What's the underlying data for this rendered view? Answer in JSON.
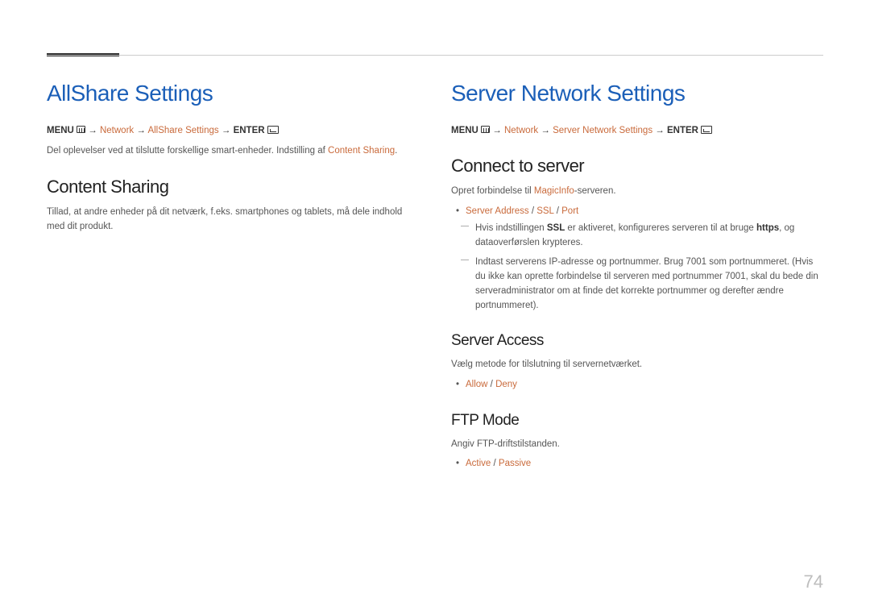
{
  "page_number": "74",
  "left": {
    "h1": "AllShare Settings",
    "crumb": {
      "menu": "MENU",
      "arrow": "→",
      "network": "Network",
      "item": "AllShare Settings",
      "enter": "ENTER"
    },
    "intro_pre": "Del oplevelser ved at tilslutte forskellige smart-enheder. Indstilling af ",
    "intro_link": "Content Sharing",
    "intro_post": ".",
    "h2": "Content Sharing",
    "p1": "Tillad, at andre enheder på dit netværk, f.eks. smartphones og tablets, må dele indhold med dit produkt."
  },
  "right": {
    "h1": "Server Network Settings",
    "crumb": {
      "menu": "MENU",
      "arrow": "→",
      "network": "Network",
      "item": "Server Network Settings",
      "enter": "ENTER"
    },
    "connect": {
      "h2": "Connect to server",
      "p_pre": "Opret forbindelse til ",
      "p_link": "MagicInfo",
      "p_post": "-serveren.",
      "bullet": {
        "a": "Server Address",
        "sep": " / ",
        "b": "SSL",
        "c": "Port"
      },
      "dash1_pre": "Hvis indstillingen ",
      "dash1_b": "SSL",
      "dash1_mid": " er aktiveret, konfigureres serveren til at bruge ",
      "dash1_b2": "https",
      "dash1_post": ", og dataoverførslen krypteres.",
      "dash2": "Indtast serverens IP-adresse og portnummer. Brug 7001 som portnummeret. (Hvis du ikke kan oprette forbindelse til serveren med portnummer 7001, skal du bede din serveradministrator om at finde det korrekte portnummer og derefter ændre portnummeret)."
    },
    "access": {
      "h3": "Server Access",
      "p": "Vælg metode for tilslutning til servernetværket.",
      "bullet": {
        "a": "Allow",
        "sep": " / ",
        "b": "Deny"
      }
    },
    "ftp": {
      "h3": "FTP Mode",
      "p": "Angiv FTP-driftstilstanden.",
      "bullet": {
        "a": "Active",
        "sep": " / ",
        "b": "Passive"
      }
    }
  }
}
